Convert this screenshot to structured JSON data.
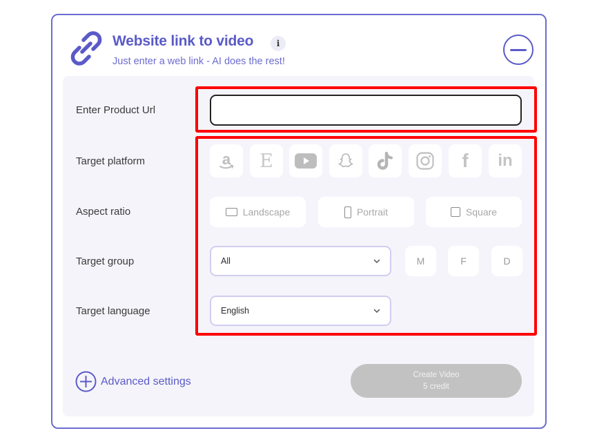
{
  "header": {
    "title": "Website link to video",
    "info_badge": "i",
    "subtitle": "Just enter a web link - AI does the rest!",
    "link_icon": "link-icon",
    "collapse_icon": "minus-circle-icon"
  },
  "form": {
    "product_url": {
      "label": "Enter Product Url",
      "value": "",
      "placeholder": ""
    },
    "target_platform": {
      "label": "Target platform",
      "options": [
        {
          "name": "Amazon",
          "icon": "amazon-icon"
        },
        {
          "name": "Etsy",
          "icon": "etsy-icon",
          "glyph": "E"
        },
        {
          "name": "YouTube",
          "icon": "youtube-icon"
        },
        {
          "name": "Snapchat",
          "icon": "snapchat-icon"
        },
        {
          "name": "TikTok",
          "icon": "tiktok-icon"
        },
        {
          "name": "Instagram",
          "icon": "instagram-icon"
        },
        {
          "name": "Facebook",
          "icon": "facebook-icon",
          "glyph": "f"
        },
        {
          "name": "LinkedIn",
          "icon": "linkedin-icon",
          "glyph": "in"
        }
      ]
    },
    "aspect_ratio": {
      "label": "Aspect ratio",
      "options": [
        {
          "label": "Landscape",
          "icon": "landscape-icon"
        },
        {
          "label": "Portrait",
          "icon": "portrait-icon"
        },
        {
          "label": "Square",
          "icon": "square-icon"
        }
      ]
    },
    "target_group": {
      "label": "Target group",
      "selected": "All",
      "genders": [
        "M",
        "F",
        "D"
      ]
    },
    "target_language": {
      "label": "Target language",
      "selected": "English"
    }
  },
  "footer": {
    "advanced_settings": "Advanced settings",
    "create_button": {
      "line1": "Create Video",
      "line2": "5 credit",
      "enabled": false
    }
  },
  "colors": {
    "accent": "#5a5ac8",
    "panel_bg": "#f5f4fb",
    "highlight": "#ff0000",
    "disabled_button": "#c2c2c2"
  }
}
